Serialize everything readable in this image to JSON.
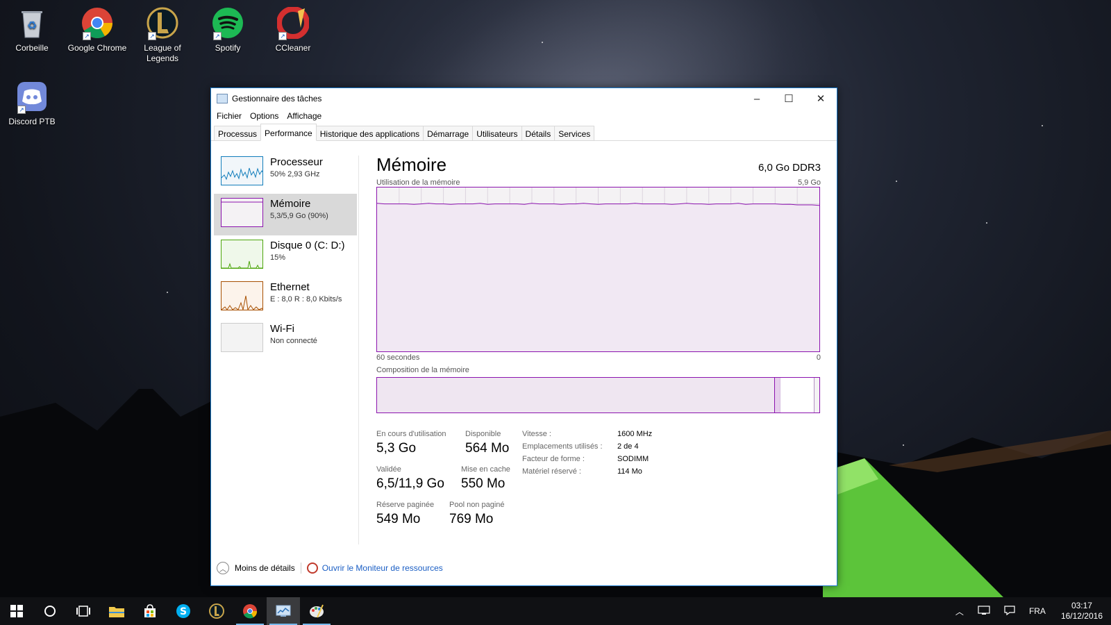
{
  "desktop": {
    "icons": [
      {
        "label": "Corbeille",
        "icon": "recycle-bin-icon"
      },
      {
        "label": "Google Chrome",
        "icon": "chrome-icon"
      },
      {
        "label": "League of Legends",
        "icon": "league-of-legends-icon"
      },
      {
        "label": "Spotify",
        "icon": "spotify-icon"
      },
      {
        "label": "CCleaner",
        "icon": "ccleaner-icon"
      },
      {
        "label": "Discord PTB",
        "icon": "discord-icon"
      }
    ]
  },
  "window": {
    "title": "Gestionnaire des tâches",
    "minimize": "–",
    "maximize": "☐",
    "close": "✕",
    "menu": [
      "Fichier",
      "Options",
      "Affichage"
    ],
    "tabs": [
      "Processus",
      "Performance",
      "Historique des applications",
      "Démarrage",
      "Utilisateurs",
      "Détails",
      "Services"
    ],
    "active_tab": "Performance"
  },
  "sidebar": {
    "items": [
      {
        "name": "Processeur",
        "sub": "50%  2,93 GHz",
        "color": "#117dbb"
      },
      {
        "name": "Mémoire",
        "sub": "5,3/5,9 Go (90%)",
        "color": "#8b12ae"
      },
      {
        "name": "Disque 0 (C: D:)",
        "sub": "15%",
        "color": "#4da60c"
      },
      {
        "name": "Ethernet",
        "sub": "E : 8,0  R : 8,0 Kbits/s",
        "color": "#a74f01"
      },
      {
        "name": "Wi-Fi",
        "sub": "Non connecté",
        "color": "#cccccc"
      }
    ]
  },
  "memory": {
    "title": "Mémoire",
    "spec": "6,0 Go DDR3",
    "chart_label": "Utilisation de la mémoire",
    "chart_max": "5,9 Go",
    "time_left": "60 secondes",
    "time_right": "0",
    "composition_label": "Composition de la mémoire",
    "usage_fraction": 0.9,
    "composition": {
      "in_use_fraction": 0.9,
      "modified_fraction": 0.012,
      "standby_fraction": 0.077
    },
    "stats": {
      "in_use_label": "En cours d'utilisation",
      "in_use": "5,3 Go",
      "available_label": "Disponible",
      "available": "564 Mo",
      "committed_label": "Validée",
      "committed": "6,5/11,9 Go",
      "cached_label": "Mise en cache",
      "cached": "550 Mo",
      "paged_label": "Réserve paginée",
      "paged": "549 Mo",
      "nonpaged_label": "Pool non paginé",
      "nonpaged": "769 Mo"
    },
    "specs": [
      {
        "k": "Vitesse :",
        "v": "1600 MHz"
      },
      {
        "k": "Emplacements utilisés :",
        "v": "2 de 4"
      },
      {
        "k": "Facteur de forme :",
        "v": "SODIMM"
      },
      {
        "k": "Matériel réservé :",
        "v": "114 Mo"
      }
    ],
    "accent": "#8b12ae"
  },
  "footer": {
    "less_details": "Moins de détails",
    "open_monitor": "Ouvrir le Moniteur de ressources"
  },
  "taskbar": {
    "apps": [
      "start-icon",
      "search-icon",
      "task-view-icon",
      "file-explorer-icon",
      "store-icon",
      "skype-icon",
      "league-of-legends-icon",
      "chrome-icon",
      "task-manager-icon",
      "paint-icon"
    ],
    "language": "FRA",
    "time": "03:17",
    "date": "16/12/2016"
  }
}
